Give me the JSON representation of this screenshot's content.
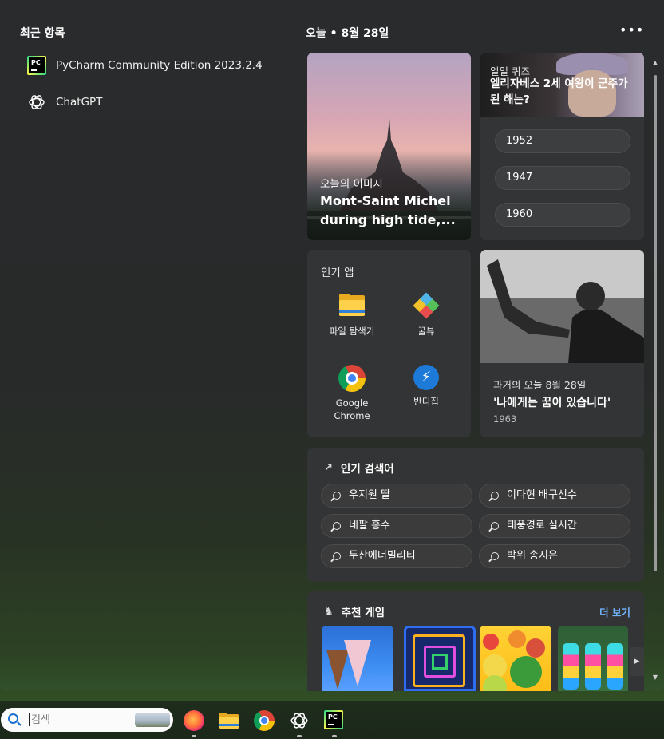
{
  "recent": {
    "title": "최근 항목",
    "items": [
      {
        "label": "PyCharm Community Edition 2023.2.4",
        "icon": "pycharm-icon"
      },
      {
        "label": "ChatGPT",
        "icon": "chatgpt-icon"
      }
    ]
  },
  "today": {
    "title": "오늘  •  8월 28일",
    "more_icon": "more-icon"
  },
  "image_of_day": {
    "kicker": "오늘의 이미지",
    "headline": "Mont-Saint Michel during high tide,..."
  },
  "quiz": {
    "kicker": "일일 퀴즈",
    "question": "엘리자베스 2세 여왕이 군주가 된 해는?",
    "options": [
      "1952",
      "1947",
      "1960"
    ]
  },
  "popular_apps": {
    "title": "인기 앱",
    "apps": [
      {
        "label": "파일 탐색기",
        "icon": "file-explorer-icon"
      },
      {
        "label": "꿀뷰",
        "icon": "honeyview-icon"
      },
      {
        "label": "Google Chrome",
        "icon": "chrome-icon"
      },
      {
        "label": "반디집",
        "icon": "bandizip-icon"
      }
    ]
  },
  "history": {
    "kicker": "과거의 오늘 8월 28일",
    "title": "'나에게는 꿈이 있습니다'",
    "year": "1963"
  },
  "trending": {
    "title": "인기 검색어",
    "icon": "trending-icon",
    "chips": [
      "우지원 딸",
      "이다현 배구선수",
      "네팔 홍수",
      "태풍경로 실시간",
      "두산에너빌리티",
      "박위 송지은"
    ]
  },
  "games": {
    "title": "추천 게임",
    "icon": "chess-icon",
    "more_label": "더 보기"
  },
  "taskbar": {
    "search_placeholder": "검색",
    "apps": [
      "firefox-icon",
      "file-explorer-icon",
      "chrome-icon",
      "chatgpt-icon",
      "pycharm-icon"
    ]
  }
}
